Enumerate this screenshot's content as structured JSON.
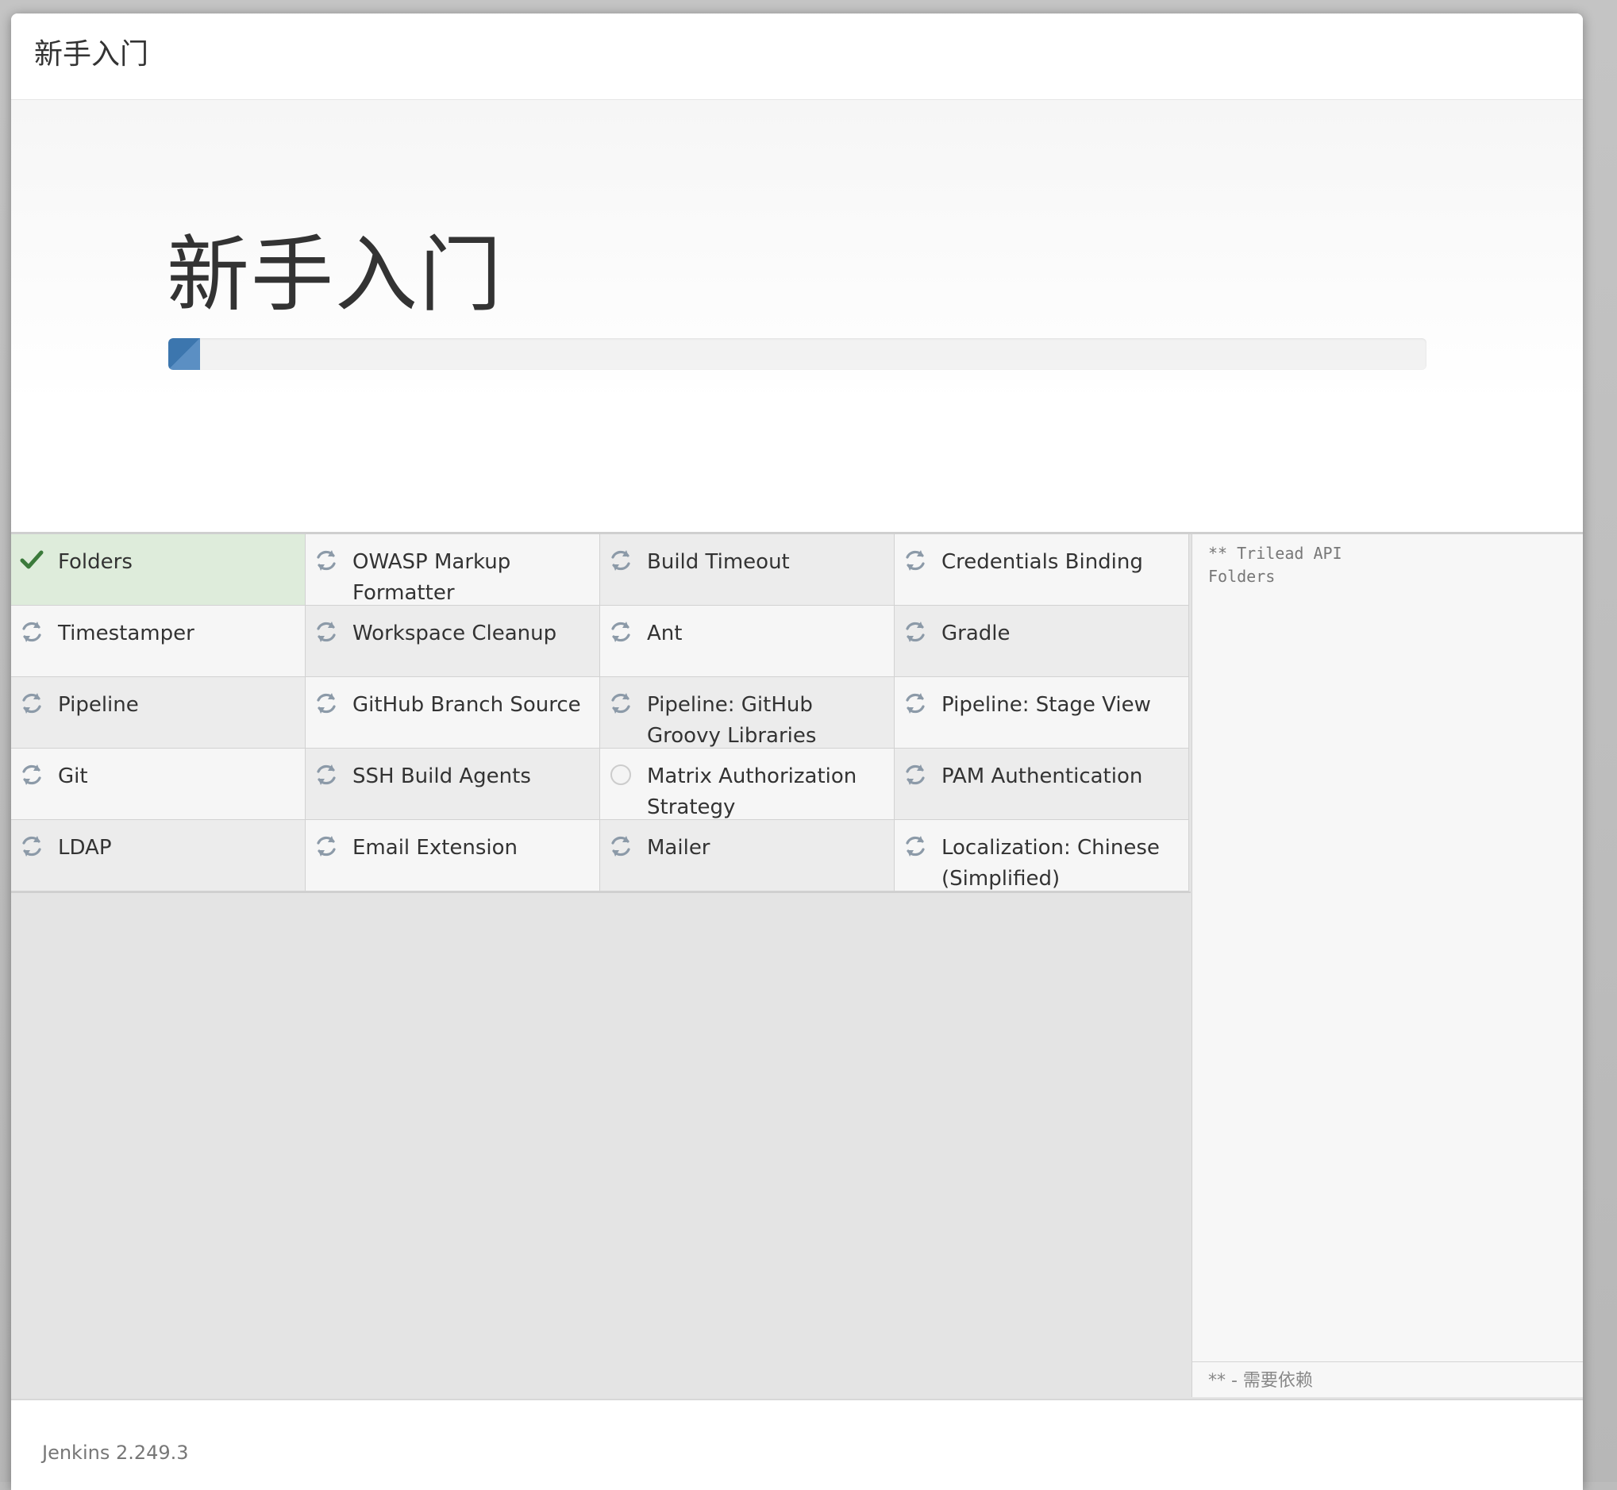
{
  "dialog": {
    "title": "新手入门"
  },
  "hero": {
    "title": "新手入门",
    "progress": 0.025
  },
  "plugins": [
    {
      "name": "Folders",
      "status": "success",
      "icon": "check-icon"
    },
    {
      "name": "OWASP Markup Formatter",
      "status": "installing",
      "icon": "refresh-icon"
    },
    {
      "name": "Build Timeout",
      "status": "installing",
      "icon": "refresh-icon"
    },
    {
      "name": "Credentials Binding",
      "status": "installing",
      "icon": "refresh-icon"
    },
    {
      "name": "Timestamper",
      "status": "installing",
      "icon": "refresh-icon"
    },
    {
      "name": "Workspace Cleanup",
      "status": "installing",
      "icon": "refresh-icon"
    },
    {
      "name": "Ant",
      "status": "installing",
      "icon": "refresh-icon"
    },
    {
      "name": "Gradle",
      "status": "installing",
      "icon": "refresh-icon"
    },
    {
      "name": "Pipeline",
      "status": "installing",
      "icon": "refresh-icon"
    },
    {
      "name": "GitHub Branch Source",
      "status": "installing",
      "icon": "refresh-icon"
    },
    {
      "name": "Pipeline: GitHub Groovy Libraries",
      "status": "installing",
      "icon": "refresh-icon"
    },
    {
      "name": "Pipeline: Stage View",
      "status": "installing",
      "icon": "refresh-icon"
    },
    {
      "name": "Git",
      "status": "installing",
      "icon": "refresh-icon"
    },
    {
      "name": "SSH Build Agents",
      "status": "installing",
      "icon": "refresh-icon"
    },
    {
      "name": "Matrix Authorization Strategy",
      "status": "pending",
      "icon": "circle-icon"
    },
    {
      "name": "PAM Authentication",
      "status": "installing",
      "icon": "refresh-icon"
    },
    {
      "name": "LDAP",
      "status": "installing",
      "icon": "refresh-icon"
    },
    {
      "name": "Email Extension",
      "status": "installing",
      "icon": "refresh-icon"
    },
    {
      "name": "Mailer",
      "status": "installing",
      "icon": "refresh-icon"
    },
    {
      "name": "Localization: Chinese (Simplified)",
      "status": "installing",
      "icon": "refresh-icon"
    }
  ],
  "install_log": {
    "lines": [
      "** Trilead API",
      "Folders"
    ],
    "legend": "** - 需要依赖"
  },
  "footer": {
    "version": "Jenkins 2.249.3"
  },
  "colors": {
    "progress": "#3c76ae",
    "success_bg": "#deecdb",
    "check": "#3b7a3b",
    "refresh": "#8c9aa8",
    "pending": "#cccccc"
  }
}
